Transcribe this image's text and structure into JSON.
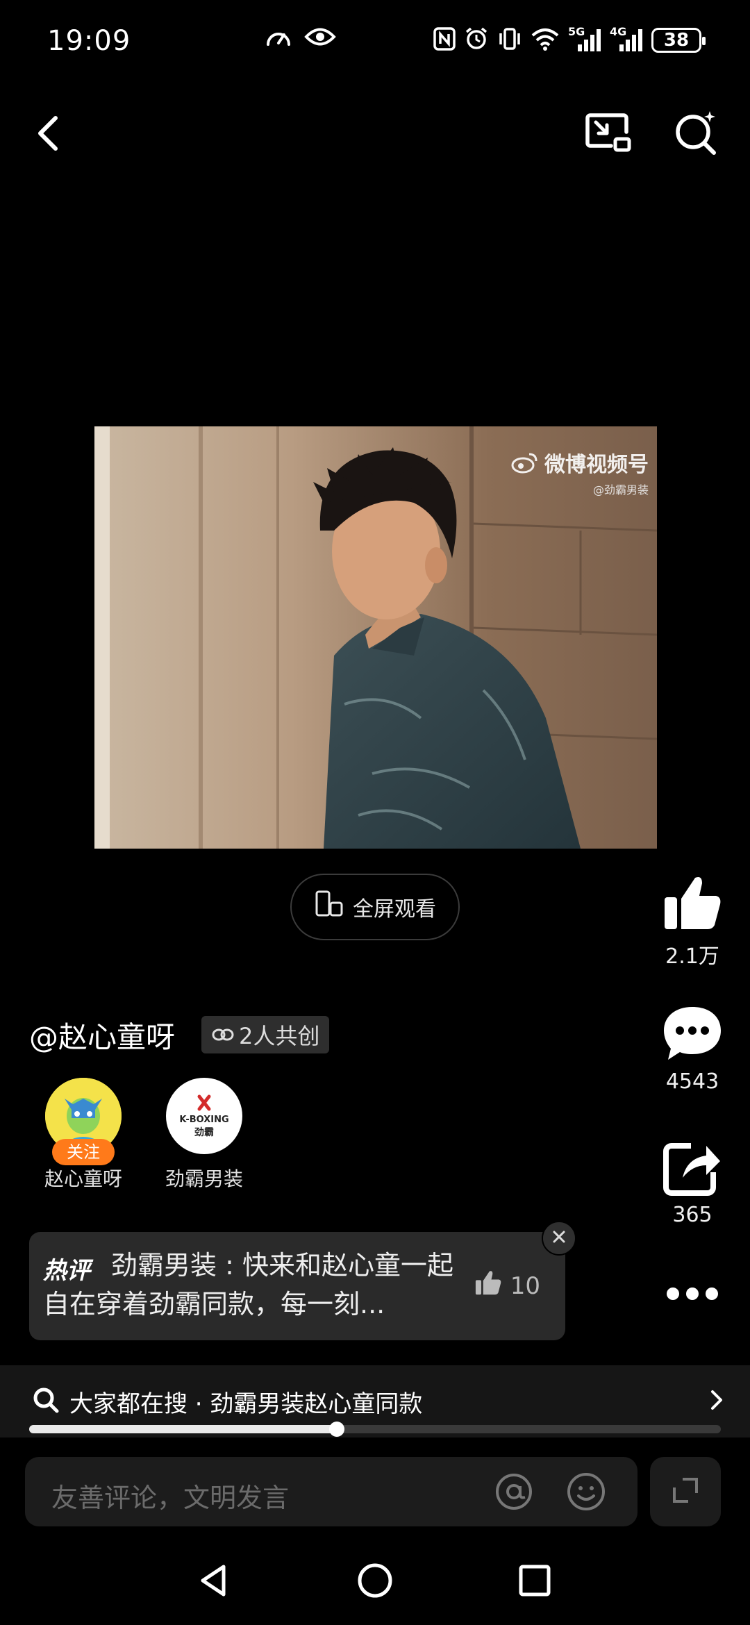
{
  "status_bar": {
    "time": "19:09",
    "battery": "38",
    "signal_5g": "5G",
    "signal_4g": "4G",
    "icons": [
      "speed-gauge-icon",
      "eye-icon",
      "nfc-icon",
      "alarm-icon",
      "vibrate-icon",
      "wifi-icon",
      "signal-5g-icon",
      "signal-4g-icon",
      "battery-icon"
    ]
  },
  "top_nav": {
    "icons": [
      "back-icon",
      "picture-in-picture-icon",
      "ai-search-icon"
    ]
  },
  "video": {
    "watermark_brand": "微博视频号",
    "watermark_account": "@劲霸男装",
    "fullscreen_label": "全屏观看"
  },
  "rail": {
    "likes": "2.1万",
    "comments": "4543",
    "shares": "365"
  },
  "author": {
    "name": "@赵心童呀",
    "cocreate": "2人共创"
  },
  "creators": [
    {
      "name": "赵心童呀",
      "follow": "关注"
    },
    {
      "name": "劲霸男装",
      "logo_top": "K-BOXING",
      "logo_bottom": "劲霸"
    }
  ],
  "hot_comment": {
    "tag": "热评",
    "author": "劲霸男装",
    "text": "劲霸男装 : 快来和赵心童一起自在穿着劲霸同款，每一刻...",
    "likes": "10"
  },
  "search_strip": {
    "text": "大家都在搜 · 劲霸男装赵心童同款"
  },
  "progress": {
    "fraction": 0.445
  },
  "comment_input": {
    "placeholder": "友善评论，文明发言"
  },
  "colors": {
    "accent_follow": "#ff7a1a",
    "background": "#000000",
    "panel": "#2a2a2a"
  }
}
